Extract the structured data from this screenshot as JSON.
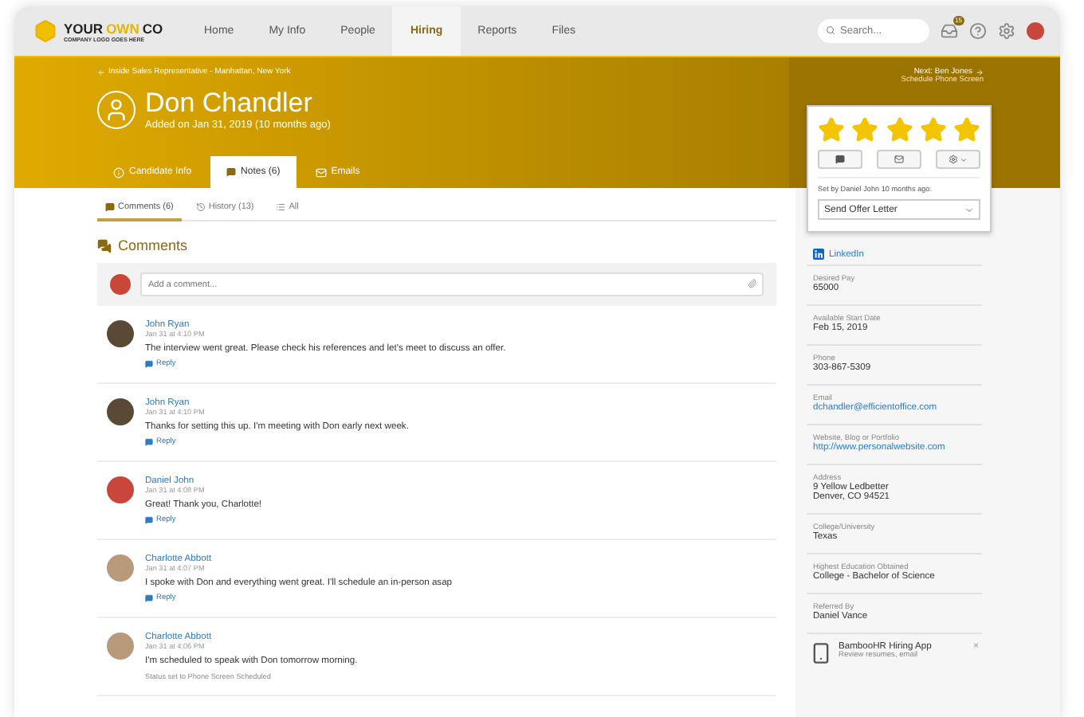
{
  "nav": {
    "logo_words": [
      {
        "text": "YOUR",
        "highlight": false
      },
      {
        "text": "OWN",
        "highlight": true
      },
      {
        "text": "CO",
        "highlight": false
      }
    ],
    "tagline": "COMPANY LOGO GOES HERE",
    "items": [
      {
        "label": "Home",
        "selected": false
      },
      {
        "label": "My Info",
        "selected": false
      },
      {
        "label": "People",
        "selected": false
      },
      {
        "label": "Hiring",
        "selected": true
      },
      {
        "label": "Reports",
        "selected": false
      },
      {
        "label": "Files",
        "selected": false
      }
    ],
    "search": {
      "placeholder": "Search..."
    },
    "inbox_badge": "15"
  },
  "banner": {
    "breadcrumb": "Inside Sales Representative - Manhattan, New York",
    "next": "Next: Ben Jones",
    "next_status": "Schedule Phone Screen",
    "name": "Don Chandler",
    "added": "Added on Jan 31, 2019 (10 months ago)",
    "tabs": [
      {
        "label": "Candidate Info",
        "kind": "info",
        "selected": false
      },
      {
        "label": "Notes (6)",
        "kind": "notes",
        "selected": true
      },
      {
        "label": "Emails",
        "kind": "mail",
        "selected": false
      }
    ]
  },
  "subtabs": [
    {
      "label": "Comments (6)",
      "kind": "comments",
      "selected": true
    },
    {
      "label": "History (13)",
      "kind": "history",
      "selected": false
    },
    {
      "label": "All",
      "kind": "list",
      "selected": false
    }
  ],
  "comments_title": "Comments",
  "comment_input": {
    "placeholder": "Add a comment..."
  },
  "comments": [
    {
      "author": "John Ryan",
      "time": "Jan 31 at 4:10 PM",
      "text": "The interview went great. Please check his references and let's meet to discuss an offer.",
      "kind": "reply",
      "footer": "Reply",
      "color": "#5a4a35"
    },
    {
      "author": "John Ryan",
      "time": "Jan 31 at 4:10 PM",
      "text": "Thanks for setting this up. I'm meeting with Don early next week.",
      "kind": "reply",
      "footer": "Reply",
      "color": "#5a4a35"
    },
    {
      "author": "Daniel John",
      "time": "Jan 31 at 4:08 PM",
      "text": "Great! Thank you, Charlotte!",
      "kind": "reply",
      "footer": "Reply",
      "color": "#c9463a"
    },
    {
      "author": "Charlotte Abbott",
      "time": "Jan 31 at 4:07 PM",
      "text": "I spoke with Don and everything went great. I'll schedule an in-person asap",
      "kind": "reply",
      "footer": "Reply",
      "color": "#b89a7a"
    },
    {
      "author": "Charlotte Abbott",
      "time": "Jan 31 at 4:06 PM",
      "text": "I'm scheduled to speak with Don tomorrow morning.",
      "kind": "status",
      "footer": "Status set to Phone Screen Scheduled",
      "color": "#b89a7a"
    }
  ],
  "rating": {
    "stars": 5,
    "set_by": "Set by Daniel John 10 months ago:",
    "status": "Send Offer Letter"
  },
  "sidebar": {
    "linkedin": "LinkedIn",
    "fields": [
      {
        "label": "Desired Pay",
        "lines": [
          "65000"
        ],
        "kind": "text"
      },
      {
        "label": "Available Start Date",
        "lines": [
          "Feb 15, 2019"
        ],
        "kind": "text"
      },
      {
        "label": "Phone",
        "lines": [
          "303-867-5309"
        ],
        "kind": "text"
      },
      {
        "label": "Email",
        "lines": [
          "dchandler@efficientoffice.com"
        ],
        "kind": "link"
      },
      {
        "label": "Website, Blog or Portfolio",
        "lines": [
          "http://www.personalwebsite.com"
        ],
        "kind": "link"
      },
      {
        "label": "Address",
        "lines": [
          "9 Yellow Ledbetter",
          "Denver, CO 94521"
        ],
        "kind": "text"
      },
      {
        "label": "College/University",
        "lines": [
          "Texas"
        ],
        "kind": "text"
      },
      {
        "label": "Highest Education Obtained",
        "lines": [
          "College - Bachelor of Science"
        ],
        "kind": "text"
      },
      {
        "label": "Referred By",
        "lines": [
          "Daniel Vance"
        ],
        "kind": "text"
      }
    ],
    "promo": {
      "title": "BambooHR Hiring App",
      "text": "Review resumes, email",
      "close": "×"
    }
  }
}
